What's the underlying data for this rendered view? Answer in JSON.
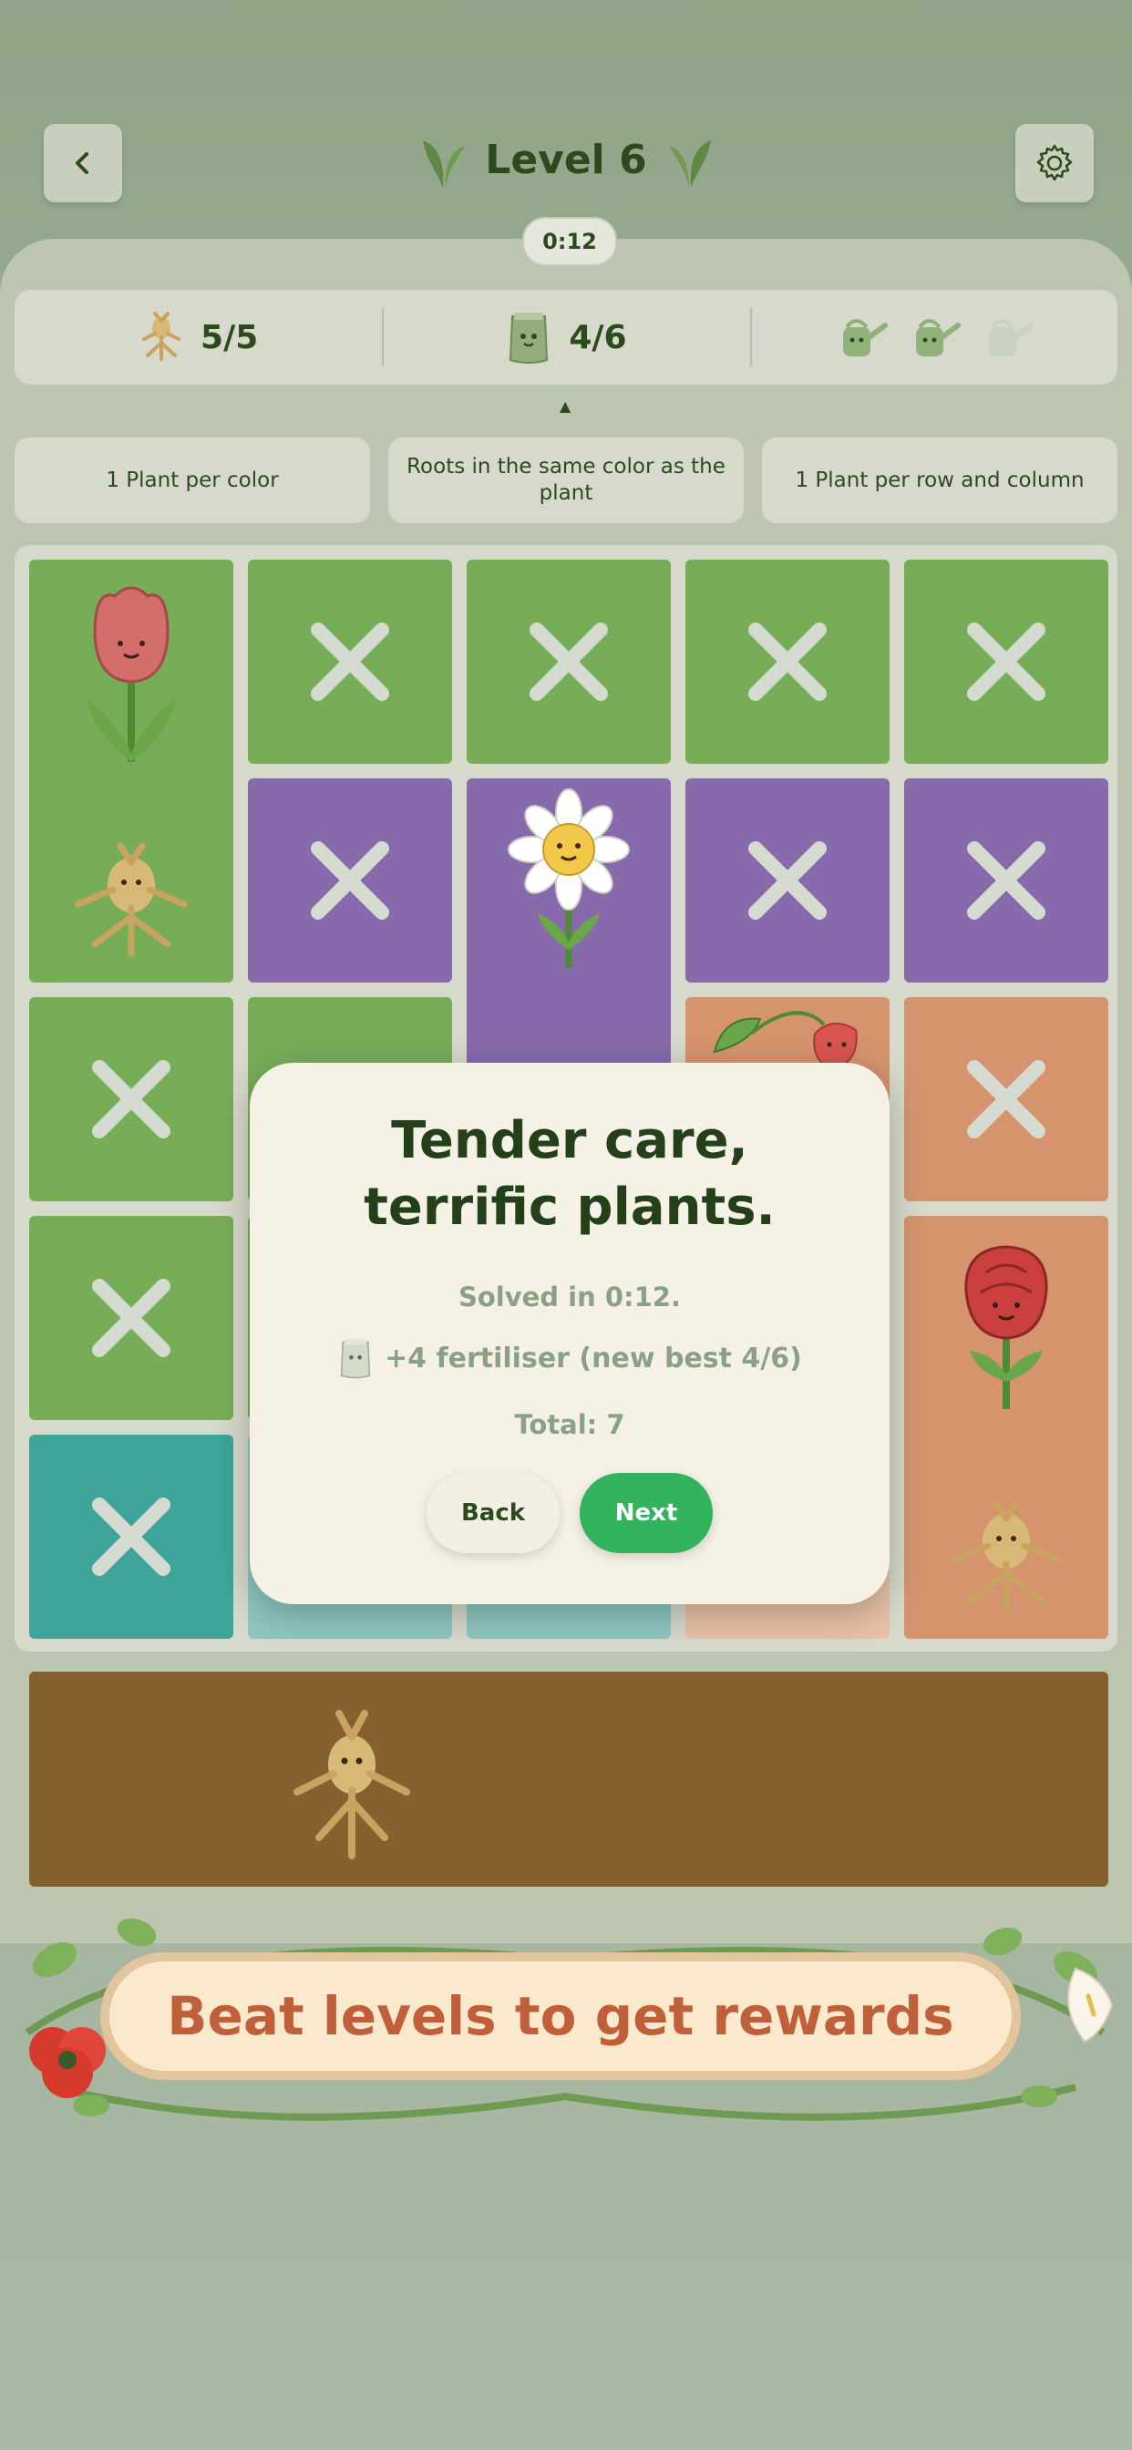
{
  "header": {
    "title": "Level 6",
    "timer": "0:12"
  },
  "stats": {
    "roots": "5/5",
    "fertiliser": "4/6",
    "watering_cans_filled": 2,
    "watering_cans_total": 3
  },
  "rules": [
    "1 Plant per color",
    "Roots in the same color as the plant",
    "1 Plant per row and column"
  ],
  "modal": {
    "title": "Tender care, terrific plants.",
    "solved": "Solved in 0:12.",
    "fertiliser": "+4 fertiliser (new best 4/6)",
    "total": "Total: 7",
    "back_label": "Back",
    "next_label": "Next"
  },
  "banner": {
    "text": "Beat levels to get rewards"
  },
  "colors": {
    "green": "#78ad58",
    "purple": "#866aab",
    "salmon": "#d5946e",
    "teal": "#3fa59b",
    "next_button": "#33b35d",
    "banner_text": "#c0603a"
  }
}
